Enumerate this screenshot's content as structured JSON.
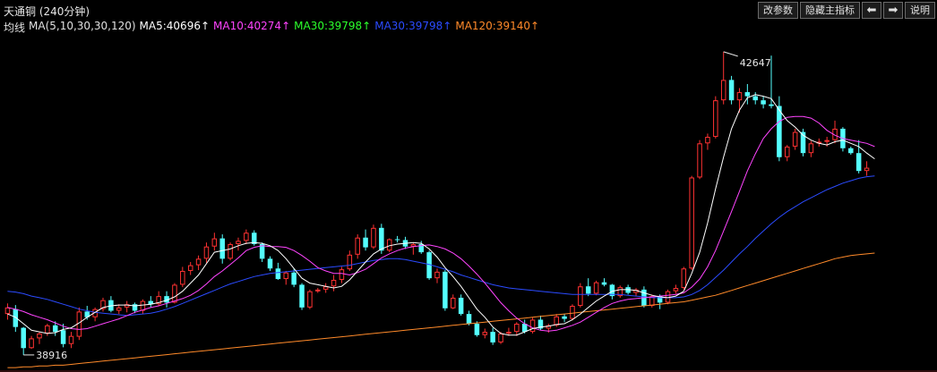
{
  "window": {
    "title": "天通铜 (240分钟)"
  },
  "toolbar": {
    "params_label": "改参数",
    "hide_indicator_label": "隐藏主指标",
    "prev_icon": "arrow-left-icon",
    "next_icon": "arrow-right-icon",
    "help_label": "说明"
  },
  "indicator": {
    "name": "均线",
    "params": "MA(5,10,30,30,120)",
    "ma5": "MA5:40696↑",
    "ma10": "MA10:40274↑",
    "ma30a": "MA30:39798↑",
    "ma30b": "MA30:39798↑",
    "ma120": "MA120:39140↑"
  },
  "colors": {
    "up": "#ff3232",
    "down": "#54ffff",
    "ma5": "#ffffff",
    "ma10": "#ff44ff",
    "ma30a": "#2cff2c",
    "ma30b": "#2b4bff",
    "ma120": "#ff8a2a",
    "grid": "#5a1a1a"
  },
  "chart_data": {
    "type": "candlestick",
    "price_range": [
      38750,
      42800
    ],
    "annotations": {
      "high": "42647",
      "low": "38916"
    },
    "candles": [
      [
        39420,
        39550,
        39350,
        39500
      ],
      [
        39480,
        39530,
        39200,
        39260
      ],
      [
        39250,
        39260,
        38916,
        39000
      ],
      [
        39000,
        39150,
        38990,
        39120
      ],
      [
        39120,
        39200,
        39050,
        39180
      ],
      [
        39180,
        39300,
        39150,
        39280
      ],
      [
        39280,
        39330,
        39150,
        39200
      ],
      [
        39220,
        39300,
        39010,
        39050
      ],
      [
        39050,
        39200,
        39000,
        39150
      ],
      [
        39140,
        39500,
        39100,
        39450
      ],
      [
        39450,
        39520,
        39350,
        39380
      ],
      [
        39380,
        39500,
        39330,
        39480
      ],
      [
        39480,
        39620,
        39450,
        39590
      ],
      [
        39590,
        39640,
        39440,
        39460
      ],
      [
        39460,
        39540,
        39420,
        39500
      ],
      [
        39500,
        39580,
        39440,
        39540
      ],
      [
        39540,
        39560,
        39430,
        39460
      ],
      [
        39460,
        39600,
        39420,
        39580
      ],
      [
        39580,
        39640,
        39500,
        39540
      ],
      [
        39540,
        39700,
        39520,
        39640
      ],
      [
        39640,
        39700,
        39500,
        39560
      ],
      [
        39560,
        39800,
        39550,
        39780
      ],
      [
        39780,
        40000,
        39750,
        39950
      ],
      [
        39950,
        40060,
        39900,
        40020
      ],
      [
        40020,
        40140,
        39960,
        40100
      ],
      [
        40100,
        40300,
        40050,
        40250
      ],
      [
        40250,
        40420,
        40200,
        40350
      ],
      [
        40350,
        40400,
        40040,
        40100
      ],
      [
        40100,
        40300,
        40080,
        40280
      ],
      [
        40280,
        40360,
        40200,
        40320
      ],
      [
        40320,
        40460,
        40280,
        40420
      ],
      [
        40420,
        40450,
        40260,
        40280
      ],
      [
        40280,
        40300,
        40060,
        40100
      ],
      [
        40100,
        40130,
        39950,
        39980
      ],
      [
        39980,
        40050,
        39840,
        39850
      ],
      [
        39850,
        39950,
        39780,
        39930
      ],
      [
        39930,
        39980,
        39750,
        39780
      ],
      [
        39780,
        39800,
        39470,
        39500
      ],
      [
        39500,
        39720,
        39480,
        39700
      ],
      [
        39700,
        39740,
        39680,
        39720
      ],
      [
        39720,
        39800,
        39680,
        39760
      ],
      [
        39760,
        39900,
        39700,
        39840
      ],
      [
        39840,
        40000,
        39800,
        39970
      ],
      [
        39970,
        40200,
        39950,
        40150
      ],
      [
        40150,
        40400,
        40100,
        40360
      ],
      [
        40360,
        40460,
        40200,
        40240
      ],
      [
        40240,
        40520,
        40220,
        40480
      ],
      [
        40480,
        40530,
        40160,
        40200
      ],
      [
        40200,
        40350,
        40180,
        40340
      ],
      [
        40340,
        40380,
        40300,
        40330
      ],
      [
        40330,
        40370,
        40220,
        40250
      ],
      [
        40250,
        40300,
        40150,
        40280
      ],
      [
        40280,
        40320,
        40160,
        40180
      ],
      [
        40180,
        40200,
        39840,
        39860
      ],
      [
        39860,
        39980,
        39800,
        39940
      ],
      [
        39940,
        39960,
        39460,
        39490
      ],
      [
        39490,
        39660,
        39480,
        39620
      ],
      [
        39620,
        39660,
        39400,
        39420
      ],
      [
        39420,
        39460,
        39280,
        39300
      ],
      [
        39300,
        39330,
        39140,
        39160
      ],
      [
        39160,
        39240,
        39120,
        39200
      ],
      [
        39200,
        39250,
        39040,
        39070
      ],
      [
        39070,
        39200,
        39050,
        39180
      ],
      [
        39180,
        39250,
        39150,
        39200
      ],
      [
        39200,
        39320,
        39150,
        39300
      ],
      [
        39300,
        39350,
        39180,
        39200
      ],
      [
        39200,
        39380,
        39180,
        39350
      ],
      [
        39350,
        39400,
        39220,
        39240
      ],
      [
        39240,
        39300,
        39190,
        39280
      ],
      [
        39280,
        39420,
        39260,
        39390
      ],
      [
        39390,
        39420,
        39320,
        39360
      ],
      [
        39360,
        39540,
        39340,
        39520
      ],
      [
        39520,
        39800,
        39500,
        39760
      ],
      [
        39760,
        39860,
        39640,
        39670
      ],
      [
        39670,
        39830,
        39650,
        39810
      ],
      [
        39810,
        39860,
        39760,
        39780
      ],
      [
        39780,
        39790,
        39600,
        39640
      ],
      [
        39640,
        39770,
        39620,
        39750
      ],
      [
        39750,
        39780,
        39660,
        39680
      ],
      [
        39680,
        39740,
        39640,
        39720
      ],
      [
        39720,
        39760,
        39500,
        39520
      ],
      [
        39520,
        39660,
        39500,
        39640
      ],
      [
        39640,
        39660,
        39480,
        39560
      ],
      [
        39560,
        39720,
        39540,
        39700
      ],
      [
        39700,
        39780,
        39670,
        39740
      ],
      [
        39740,
        40000,
        39720,
        39980
      ],
      [
        39980,
        41120,
        39960,
        41100
      ],
      [
        41100,
        41560,
        41080,
        41520
      ],
      [
        41520,
        41640,
        41440,
        41600
      ],
      [
        41600,
        42100,
        41580,
        42050
      ],
      [
        42050,
        42647,
        42000,
        42300
      ],
      [
        42300,
        42350,
        42000,
        42050
      ],
      [
        42050,
        42200,
        41900,
        42150
      ],
      [
        42150,
        42250,
        42000,
        42100
      ],
      [
        42100,
        42150,
        42000,
        42050
      ],
      [
        42050,
        42100,
        41950,
        42000
      ],
      [
        42000,
        42600,
        41950,
        41980
      ],
      [
        41980,
        42100,
        41300,
        41350
      ],
      [
        41350,
        41500,
        41300,
        41480
      ],
      [
        41480,
        41700,
        41440,
        41660
      ],
      [
        41660,
        41700,
        41360,
        41400
      ],
      [
        41400,
        41550,
        41350,
        41520
      ],
      [
        41520,
        41580,
        41480,
        41540
      ],
      [
        41540,
        41600,
        41480,
        41560
      ],
      [
        41560,
        41800,
        41520,
        41700
      ],
      [
        41700,
        41720,
        41420,
        41460
      ],
      [
        41460,
        41480,
        41380,
        41400
      ],
      [
        41400,
        41560,
        41150,
        41180
      ],
      [
        41180,
        41300,
        41120,
        41220
      ]
    ],
    "ma5": [
      39420,
      39380,
      39300,
      39220,
      39200,
      39180,
      39190,
      39230,
      39250,
      39310,
      39380,
      39440,
      39500,
      39520,
      39530,
      39530,
      39520,
      39530,
      39540,
      39560,
      39590,
      39630,
      39700,
      39800,
      39900,
      40040,
      40180,
      40200,
      40220,
      40260,
      40290,
      40300,
      40290,
      40260,
      40200,
      40100,
      39980,
      39860,
      39800,
      39780,
      39760,
      39740,
      39760,
      39840,
      39950,
      40060,
      40160,
      40220,
      40260,
      40280,
      40290,
      40300,
      40290,
      40220,
      40120,
      39990,
      39880,
      39760,
      39620,
      39480,
      39380,
      39260,
      39180,
      39160,
      39160,
      39200,
      39240,
      39260,
      39270,
      39290,
      39300,
      39350,
      39420,
      39500,
      39580,
      39640,
      39700,
      39720,
      39720,
      39710,
      39680,
      39650,
      39630,
      39620,
      39640,
      39700,
      39920,
      40180,
      40540,
      40960,
      41350,
      41700,
      41930,
      42080,
      42120,
      42100,
      42070,
      41930,
      41800,
      41720,
      41620,
      41560,
      41520,
      41500,
      41540,
      41560,
      41520,
      41480,
      41400,
      41330
    ],
    "ma10": [
      39500,
      39480,
      39450,
      39410,
      39380,
      39350,
      39310,
      39270,
      39240,
      39230,
      39240,
      39270,
      39300,
      39330,
      39360,
      39400,
      39440,
      39470,
      39500,
      39520,
      39550,
      39580,
      39610,
      39650,
      39710,
      39790,
      39880,
      39950,
      40030,
      40110,
      40200,
      40240,
      40260,
      40250,
      40250,
      40240,
      40200,
      40140,
      40070,
      39990,
      39950,
      39920,
      39920,
      39900,
      39930,
      39970,
      40040,
      40110,
      40160,
      40200,
      40230,
      40250,
      40260,
      40270,
      40250,
      40220,
      40170,
      40100,
      40010,
      39910,
      39800,
      39680,
      39560,
      39460,
      39370,
      39300,
      39250,
      39220,
      39210,
      39220,
      39250,
      39280,
      39320,
      39380,
      39440,
      39500,
      39550,
      39580,
      39600,
      39610,
      39620,
      39630,
      39640,
      39650,
      39660,
      39680,
      39750,
      39850,
      40000,
      40200,
      40440,
      40680,
      40930,
      41180,
      41390,
      41580,
      41700,
      41790,
      41840,
      41850,
      41850,
      41830,
      41770,
      41680,
      41620,
      41580,
      41560,
      41540,
      41520,
      41480
    ],
    "ma30b": [
      39700,
      39690,
      39670,
      39640,
      39620,
      39600,
      39570,
      39540,
      39510,
      39480,
      39460,
      39440,
      39430,
      39420,
      39410,
      39400,
      39410,
      39420,
      39430,
      39450,
      39480,
      39510,
      39550,
      39590,
      39630,
      39670,
      39710,
      39750,
      39790,
      39820,
      39850,
      39880,
      39900,
      39920,
      39930,
      39940,
      39950,
      39960,
      39970,
      39980,
      39990,
      40000,
      40010,
      40020,
      40040,
      40060,
      40080,
      40090,
      40100,
      40100,
      40090,
      40070,
      40050,
      40030,
      40000,
      39970,
      39940,
      39900,
      39870,
      39840,
      39810,
      39780,
      39760,
      39740,
      39730,
      39720,
      39710,
      39700,
      39690,
      39680,
      39670,
      39660,
      39660,
      39660,
      39660,
      39660,
      39660,
      39660,
      39650,
      39640,
      39630,
      39620,
      39620,
      39620,
      39620,
      39630,
      39660,
      39710,
      39780,
      39870,
      39960,
      40060,
      40160,
      40250,
      40350,
      40440,
      40530,
      40610,
      40680,
      40740,
      40800,
      40850,
      40900,
      40950,
      40990,
      41030,
      41060,
      41090,
      41110,
      41120
    ],
    "ma120": [
      38760,
      38760,
      38770,
      38770,
      38780,
      38780,
      38790,
      38790,
      38800,
      38810,
      38820,
      38830,
      38840,
      38850,
      38860,
      38870,
      38880,
      38890,
      38900,
      38910,
      38920,
      38930,
      38940,
      38950,
      38960,
      38970,
      38980,
      38990,
      39000,
      39010,
      39020,
      39030,
      39040,
      39050,
      39060,
      39070,
      39080,
      39090,
      39100,
      39110,
      39120,
      39130,
      39140,
      39150,
      39160,
      39170,
      39180,
      39190,
      39200,
      39210,
      39220,
      39230,
      39240,
      39250,
      39260,
      39270,
      39280,
      39290,
      39300,
      39310,
      39320,
      39330,
      39340,
      39350,
      39360,
      39370,
      39380,
      39390,
      39400,
      39410,
      39420,
      39430,
      39440,
      39450,
      39460,
      39470,
      39480,
      39490,
      39500,
      39510,
      39520,
      39530,
      39540,
      39550,
      39560,
      39570,
      39590,
      39610,
      39630,
      39650,
      39680,
      39710,
      39740,
      39770,
      39800,
      39830,
      39860,
      39890,
      39920,
      39950,
      39980,
      40010,
      40040,
      40070,
      40100,
      40120,
      40140,
      40150,
      40160,
      40170
    ]
  }
}
